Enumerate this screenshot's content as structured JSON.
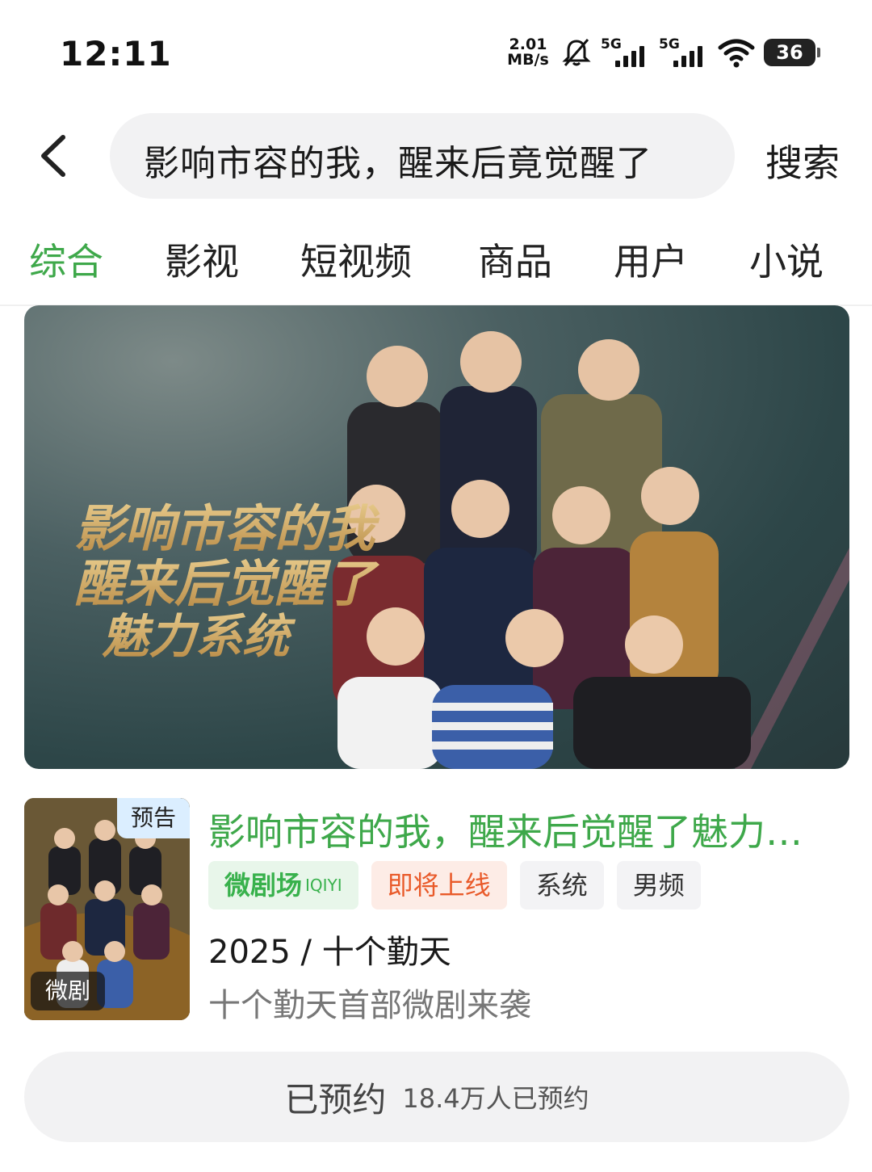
{
  "status_bar": {
    "time": "12:11",
    "speed_value": "2.01",
    "speed_unit": "MB/s",
    "signal1_label": "5G",
    "signal2_label": "5G",
    "battery": "36"
  },
  "search": {
    "query": "影响市容的我，醒来后竟觉醒了",
    "button_label": "搜索"
  },
  "tabs": [
    {
      "label": "综合",
      "active": true
    },
    {
      "label": "影视",
      "active": false
    },
    {
      "label": "短视频",
      "active": false
    },
    {
      "label": "商品",
      "active": false
    },
    {
      "label": "用户",
      "active": false
    },
    {
      "label": "小说",
      "active": false
    }
  ],
  "banner": {
    "art_title_lines": [
      "影响市容的我",
      "醒来后觉醒了",
      "魅力系统"
    ]
  },
  "result": {
    "poster_badge_top": "预告",
    "poster_badge_bottom": "微剧",
    "title": "影响市容的我，醒来后觉醒了魅力…",
    "chips": {
      "platform": "微剧场",
      "platform_small": "IQIYI",
      "status": "即将上线",
      "tag1": "系统",
      "tag2": "男频"
    },
    "meta": "2025 / 十个勤天",
    "description": "十个勤天首部微剧来袭"
  },
  "reserve": {
    "label": "已预约",
    "count": "18.4万人已预约"
  },
  "colors": {
    "accent": "#3ea84a",
    "status_orange": "#e95a2a"
  }
}
